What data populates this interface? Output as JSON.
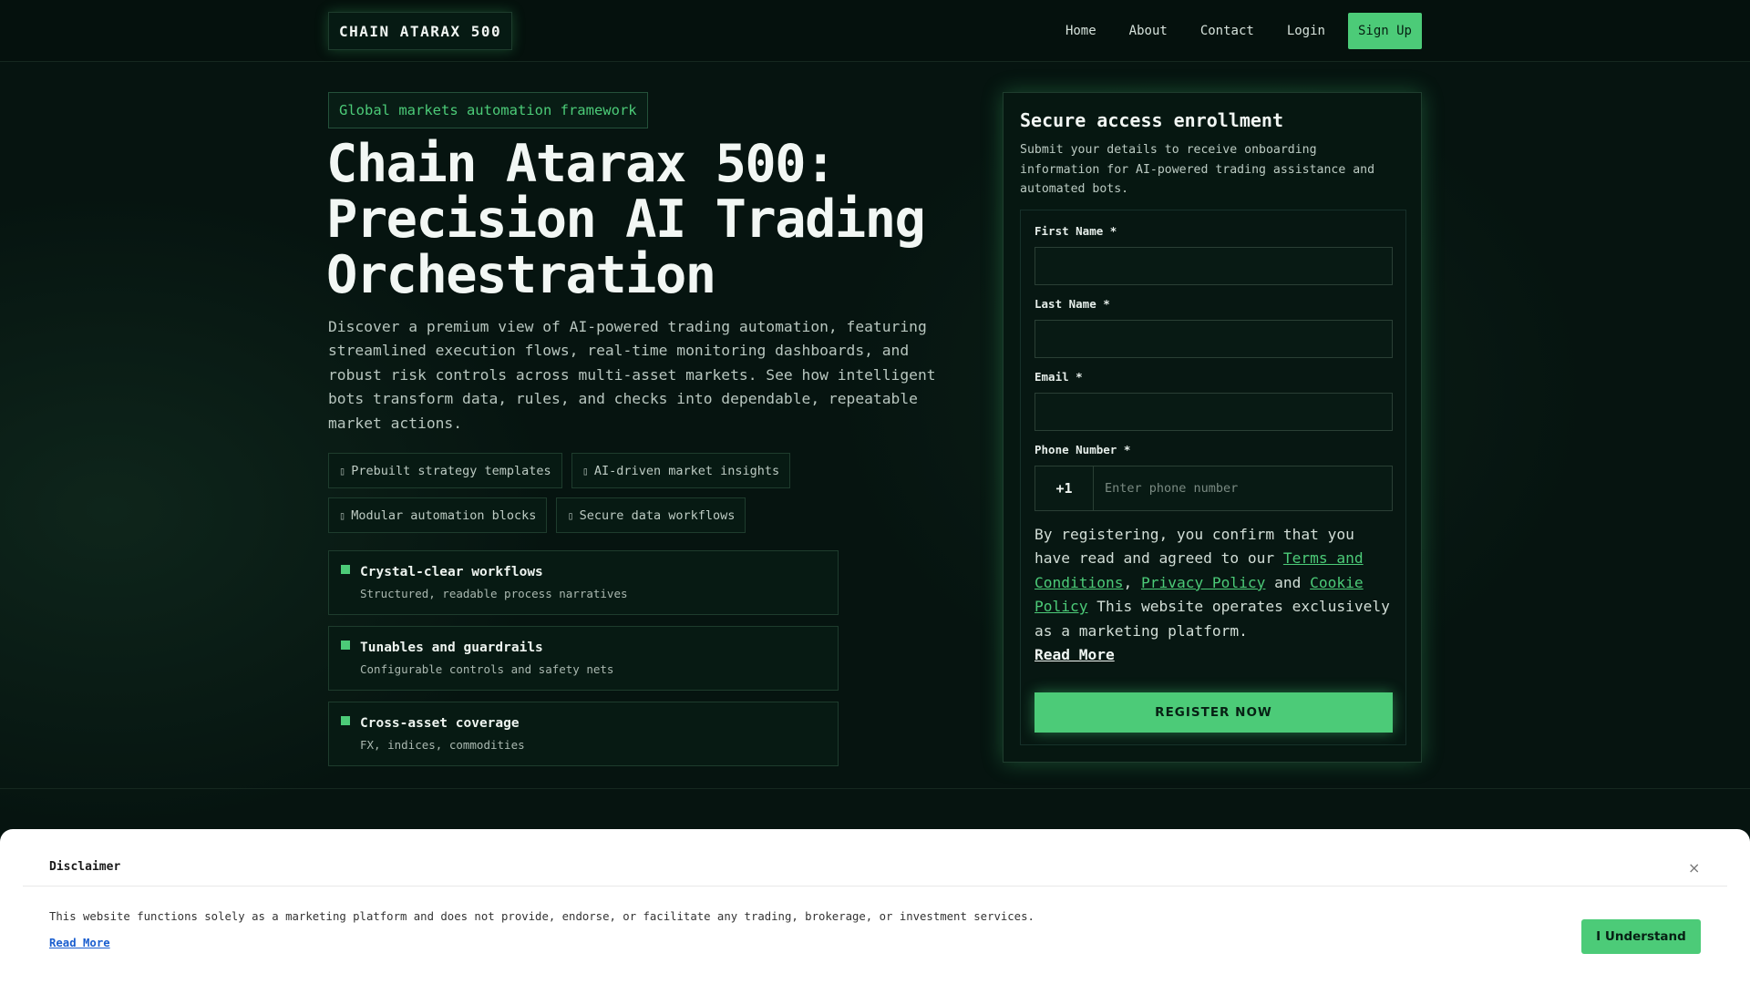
{
  "header": {
    "logo": "CHAIN ATARAX 500",
    "nav": [
      "Home",
      "About",
      "Contact",
      "Login"
    ],
    "signup": "Sign Up"
  },
  "hero": {
    "tagline": "Global markets automation framework",
    "title": "Chain Atarax 500: Precision AI Trading Orchestration",
    "description": "Discover a premium view of AI-powered trading automation, featuring streamlined execution flows, real-time monitoring dashboards, and robust risk controls across multi-asset markets. See how intelligent bots transform data, rules, and checks into dependable, repeatable market actions.",
    "chips": [
      {
        "glyph": "▯",
        "text": "Prebuilt strategy templates"
      },
      {
        "glyph": "▯",
        "text": "AI-driven market insights"
      },
      {
        "glyph": "▯",
        "text": "Modular automation blocks"
      },
      {
        "glyph": "▯",
        "text": "Secure data workflows"
      }
    ],
    "features": [
      {
        "title": "Crystal-clear workflows",
        "subtitle": "Structured, readable process narratives"
      },
      {
        "title": "Tunables and guardrails",
        "subtitle": "Configurable controls and safety nets"
      },
      {
        "title": "Cross-asset coverage",
        "subtitle": "FX, indices, commodities"
      }
    ]
  },
  "form": {
    "title": "Secure access enrollment",
    "subtitle": "Submit your details to receive onboarding information for AI-powered trading assistance and automated bots.",
    "first_name_label": "First Name *",
    "last_name_label": "Last Name *",
    "email_label": "Email *",
    "phone_label": "Phone Number *",
    "phone_code": "+1",
    "phone_placeholder": "Enter phone number",
    "consent_prefix": "By registering, you confirm that you have read and agreed to our ",
    "terms": "Terms and Conditions",
    "comma": ", ",
    "privacy": "Privacy Policy",
    "and": " and ",
    "cookie": "Cookie Policy",
    "consent_suffix": " This website operates exclusively as a marketing platform.",
    "read_more": "Read More",
    "submit": "REGISTER NOW"
  },
  "disclaimer": {
    "title": "Disclaimer",
    "close": "×",
    "text": "This website functions solely as a marketing platform and does not provide, endorse, or facilitate any trading, brokerage, or investment services.",
    "read_more": "Read More",
    "button": "I Understand"
  },
  "colors": {
    "accent": "#4ccb78",
    "background": "#061410",
    "panel": "#061711"
  }
}
